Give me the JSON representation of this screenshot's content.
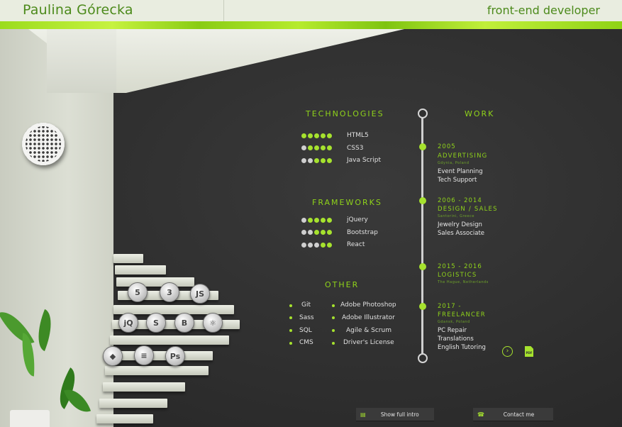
{
  "header": {
    "name": "Paulina Górecka",
    "role": "front-end developer"
  },
  "headings": {
    "technologies": "TECHNOLOGIES",
    "frameworks": "FRAMEWORKS",
    "other": "OTHER",
    "work": "WORK"
  },
  "technologies": [
    {
      "name": "HTML5",
      "level": 5
    },
    {
      "name": "CSS3",
      "level": 4
    },
    {
      "name": "Java Script",
      "level": 3
    }
  ],
  "frameworks": [
    {
      "name": "jQuery",
      "level": 4
    },
    {
      "name": "Bootstrap",
      "level": 3
    },
    {
      "name": "React",
      "level": 2
    }
  ],
  "other_left": [
    "Git",
    "Sass",
    "SQL",
    "CMS"
  ],
  "other_right": [
    "Adobe Photoshop",
    "Adobe Illustrator",
    "Agile & Scrum",
    "Driver's License"
  ],
  "work": [
    {
      "years": "2005",
      "title": "ADVERTISING",
      "location": "Gdynia, Poland",
      "desc": [
        "Event Planning",
        "Tech Support"
      ]
    },
    {
      "years": "2006 - 2014",
      "title": "DESIGN / SALES",
      "location": "Santorini, Greece",
      "desc": [
        "Jewelry Design",
        "Sales Associate"
      ]
    },
    {
      "years": "2015 - 2016",
      "title": "LOGISTICS",
      "location": "The Hague, Netherlands",
      "desc": []
    },
    {
      "years": "2017 -",
      "title": "FREELANCER",
      "location": "Gdansk, Poland",
      "desc": [
        "PC Repair",
        "Translations",
        "English Tutoring"
      ]
    }
  ],
  "stair_icons": [
    "html5-icon",
    "css3-icon",
    "javascript-icon",
    "jquery-icon",
    "sass-icon",
    "bootstrap-icon",
    "react-icon",
    "git-icon",
    "database-icon",
    "photoshop-icon"
  ],
  "buttons": {
    "intro": "Show full intro",
    "contact": "Contact me",
    "pdf": "PDF"
  },
  "colors": {
    "accent": "#a6e22e",
    "brand_text": "#4c8a1b",
    "board": "#2e2e2e"
  }
}
